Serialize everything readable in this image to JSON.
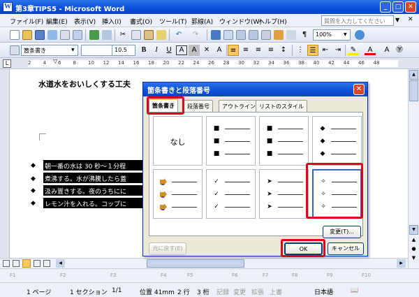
{
  "window": {
    "title": "第3章TIPS5 - Microsoft Word"
  },
  "menu": [
    "ファイル(F)",
    "編集(E)",
    "表示(V)",
    "挿入(I)",
    "書式(O)",
    "ツール(T)",
    "罫線(A)",
    "ウィンドウ(W)",
    "ヘルプ(H)"
  ],
  "help_placeholder": "質問を入力してください",
  "toolbar": {
    "zoom": "100%",
    "style": "箇条書き",
    "font_size": "10.5"
  },
  "ruler_numbers": [
    "2",
    "4",
    "6",
    "8",
    "10",
    "12",
    "14",
    "16",
    "18",
    "20",
    "22",
    "24",
    "26",
    "28",
    "30",
    "32",
    "34",
    "36",
    "38",
    "40",
    "42",
    "44",
    "46",
    "48"
  ],
  "document": {
    "heading": "水道水をおいしくする工夫",
    "bullet_char": "◆",
    "items": [
      "朝一番の水は 30 秒～１分程",
      "煮沸する。水が沸騰したら蓋",
      "汲み置きする。夜のうちにに",
      "レモン汁を入れる。コップに"
    ]
  },
  "dialog": {
    "title": "箇条書きと段落番号",
    "tabs": [
      "箇条書き",
      "段落番号",
      "アウトライン",
      "リストのスタイル"
    ],
    "active_tab": 0,
    "none_label": "なし",
    "styles": [
      "none",
      "■",
      "■",
      "◆",
      "arrow-icon",
      "✓",
      "➤",
      "✧"
    ],
    "selected_style": 7,
    "change_button": "変更(T)...",
    "reset_button": "元に戻す(E)",
    "ok_button": "OK",
    "cancel_button": "キャンセル"
  },
  "fkeys": [
    "F1",
    "F2",
    "F3",
    "F4",
    "F5",
    "F6",
    "F7",
    "F8",
    "F9",
    "F10"
  ],
  "status": {
    "page": "1 ページ",
    "section": "1 セクション",
    "pages": "1/1",
    "position": "位置 41mm",
    "line": "2 行",
    "column": "3 桁",
    "rec": "記録",
    "trk": "変更",
    "ext": "拡張",
    "ovr": "上書",
    "language": "日本語"
  },
  "colors": {
    "title_blue": "#0a4fd6",
    "highlight_red": "#e0001b",
    "tab_accent": "#ffc83c"
  }
}
